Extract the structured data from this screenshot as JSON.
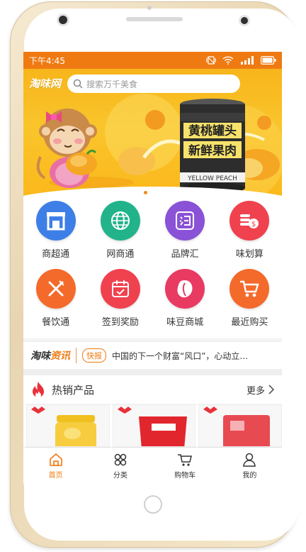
{
  "status_bar": {
    "time": "下午4:45"
  },
  "header": {
    "logo": "淘味网",
    "search_placeholder": "搜索万千美食"
  },
  "banner": {
    "can_title": "黄桃罐头",
    "can_subtitle": "新鲜果肉",
    "can_en": "YELLOW PEACH"
  },
  "grid": [
    {
      "label": "商超通",
      "icon": "store-icon",
      "color": "#3d7fe6"
    },
    {
      "label": "网商通",
      "icon": "globe-icon",
      "color": "#22b38a"
    },
    {
      "label": "品牌汇",
      "icon": "brand-icon",
      "color": "#8a52d6"
    },
    {
      "label": "味划算",
      "icon": "coins-icon",
      "color": "#f0414f"
    },
    {
      "label": "餐饮通",
      "icon": "utensils-icon",
      "color": "#f46a2b"
    },
    {
      "label": "签到奖励",
      "icon": "calendar-check-icon",
      "color": "#f0414f"
    },
    {
      "label": "味豆商城",
      "icon": "bean-icon",
      "color": "#e93a62"
    },
    {
      "label": "最近购买",
      "icon": "cart-icon",
      "color": "#f46a2b"
    }
  ],
  "news": {
    "logo_a": "淘味",
    "logo_b": "资讯",
    "tag": "快报",
    "text": "中国的下一个财富“风口”，心动立..."
  },
  "hot": {
    "title": "热销产品",
    "more": "更多"
  },
  "tabs": [
    {
      "label": "首页",
      "icon": "home-icon",
      "active": true
    },
    {
      "label": "分类",
      "icon": "category-icon",
      "active": false
    },
    {
      "label": "购物车",
      "icon": "cart-icon",
      "active": false
    },
    {
      "label": "我的",
      "icon": "user-icon",
      "active": false
    }
  ]
}
